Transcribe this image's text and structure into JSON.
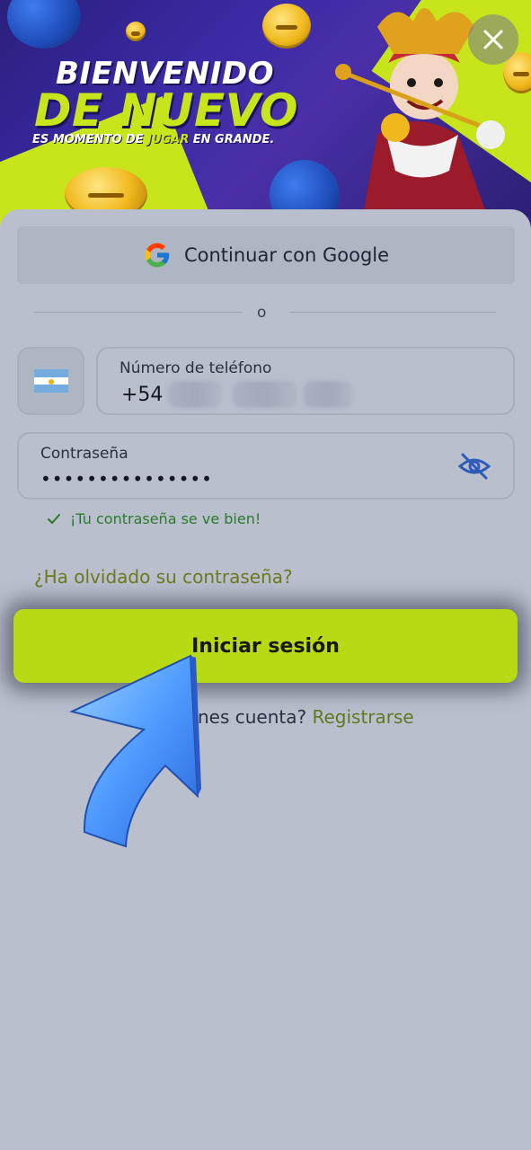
{
  "banner": {
    "headline_line1": "BIENVENIDO",
    "headline_line2": "DE NUEVO",
    "tagline_before": "ES MOMENTO DE ",
    "tagline_highlight": "JUGAR",
    "tagline_after": " EN GRANDE."
  },
  "close_icon": "close-icon",
  "google": {
    "label": "Continuar con Google"
  },
  "divider": {
    "text": "o"
  },
  "phone": {
    "country_flag": "argentina-flag-icon",
    "label": "Número de teléfono",
    "prefix": "+54"
  },
  "password": {
    "label": "Contraseña",
    "value": "•••••••••••••••",
    "toggle_icon": "eye-off-icon"
  },
  "validation": {
    "text": "¡Tu contraseña se ve bien!"
  },
  "forgot": {
    "text": "¿Ha olvidado su contraseña?"
  },
  "login": {
    "label": "Iniciar sesión"
  },
  "register": {
    "prompt": "nes cuenta? ",
    "link": "Registrarse"
  },
  "colors": {
    "accent": "#b8da14",
    "background": "#b9bfcd",
    "success": "#2b7a2b",
    "link": "#6b7a1f"
  }
}
